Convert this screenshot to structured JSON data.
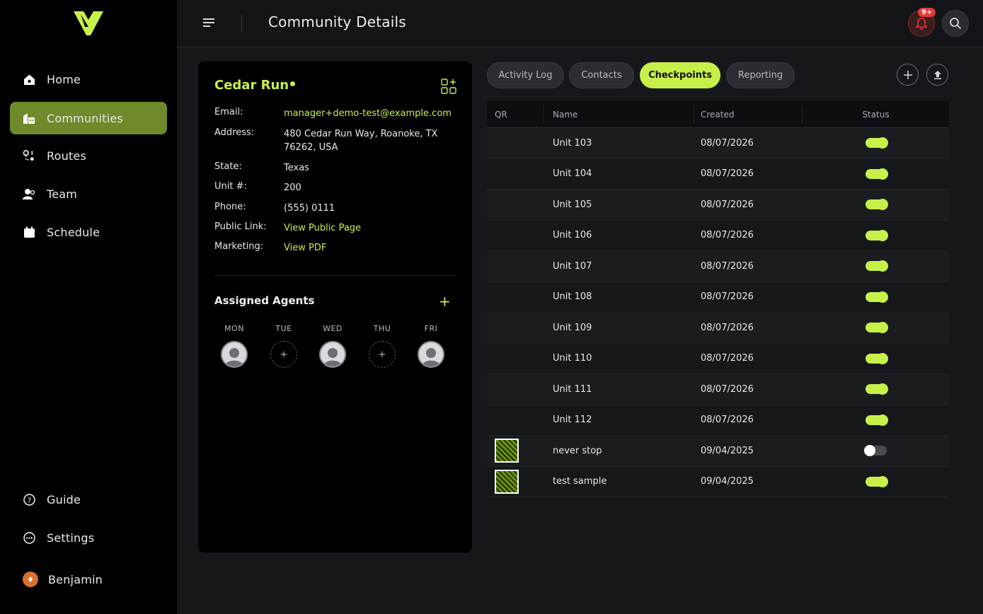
{
  "sidebar": {
    "nav": [
      {
        "label": "Home",
        "icon": "home-icon"
      },
      {
        "label": "Communities",
        "icon": "building-icon"
      },
      {
        "label": "Routes",
        "icon": "route-icon"
      },
      {
        "label": "Team",
        "icon": "team-icon"
      },
      {
        "label": "Schedule",
        "icon": "calendar-icon"
      }
    ],
    "bottom": [
      {
        "label": "Guide",
        "icon": "help-icon"
      },
      {
        "label": "Settings",
        "icon": "settings-icon"
      }
    ],
    "user": {
      "name": "Benjamin",
      "avatar_glyph": "♦"
    }
  },
  "header": {
    "title": "Community Details",
    "notifications_badge": "9+"
  },
  "community": {
    "name": "Cedar Run",
    "fields": [
      {
        "label": "Email:",
        "value": "manager+demo-test@example.com"
      },
      {
        "label": "Address:",
        "value": "480 Cedar Run Way, Roanoke, TX 76262, USA"
      },
      {
        "label": "State:",
        "value": "Texas"
      },
      {
        "label": "Unit #:",
        "value": "200"
      },
      {
        "label": "Phone:",
        "value": "(555) 0111"
      },
      {
        "label": "Public Link:",
        "value": "View Public Page"
      },
      {
        "label": "Marketing:",
        "value": "View PDF"
      }
    ],
    "agents_title": "Assigned Agents",
    "days": [
      {
        "day": "MON",
        "assigned": true
      },
      {
        "day": "TUE",
        "assigned": false
      },
      {
        "day": "WED",
        "assigned": true
      },
      {
        "day": "THU",
        "assigned": false
      },
      {
        "day": "FRI",
        "assigned": true
      }
    ],
    "empty_slot_glyph": "+"
  },
  "tabs": [
    {
      "label": "Activity Log",
      "active": false
    },
    {
      "label": "Contacts",
      "active": false
    },
    {
      "label": "Checkpoints",
      "active": true
    },
    {
      "label": "Reporting",
      "active": false
    }
  ],
  "table": {
    "columns": [
      "QR",
      "Name",
      "Created",
      "Status"
    ],
    "rows": [
      {
        "qr": false,
        "name": "Unit 103",
        "created": "08/07/2026",
        "active": true
      },
      {
        "qr": false,
        "name": "Unit 104",
        "created": "08/07/2026",
        "active": true
      },
      {
        "qr": false,
        "name": "Unit 105",
        "created": "08/07/2026",
        "active": true
      },
      {
        "qr": false,
        "name": "Unit 106",
        "created": "08/07/2026",
        "active": true
      },
      {
        "qr": false,
        "name": "Unit 107",
        "created": "08/07/2026",
        "active": true
      },
      {
        "qr": false,
        "name": "Unit 108",
        "created": "08/07/2026",
        "active": true
      },
      {
        "qr": false,
        "name": "Unit 109",
        "created": "08/07/2026",
        "active": true
      },
      {
        "qr": false,
        "name": "Unit 110",
        "created": "08/07/2026",
        "active": true
      },
      {
        "qr": false,
        "name": "Unit 111",
        "created": "08/07/2026",
        "active": true
      },
      {
        "qr": false,
        "name": "Unit 112",
        "created": "08/07/2026",
        "active": true
      },
      {
        "qr": true,
        "name": "never stop",
        "created": "09/04/2025",
        "active": false
      },
      {
        "qr": true,
        "name": "test sample",
        "created": "09/04/2025",
        "active": true
      }
    ]
  },
  "colors": {
    "accent": "#c8f04a",
    "active_nav": "#6f8a2a",
    "badge": "#e23a3a"
  }
}
